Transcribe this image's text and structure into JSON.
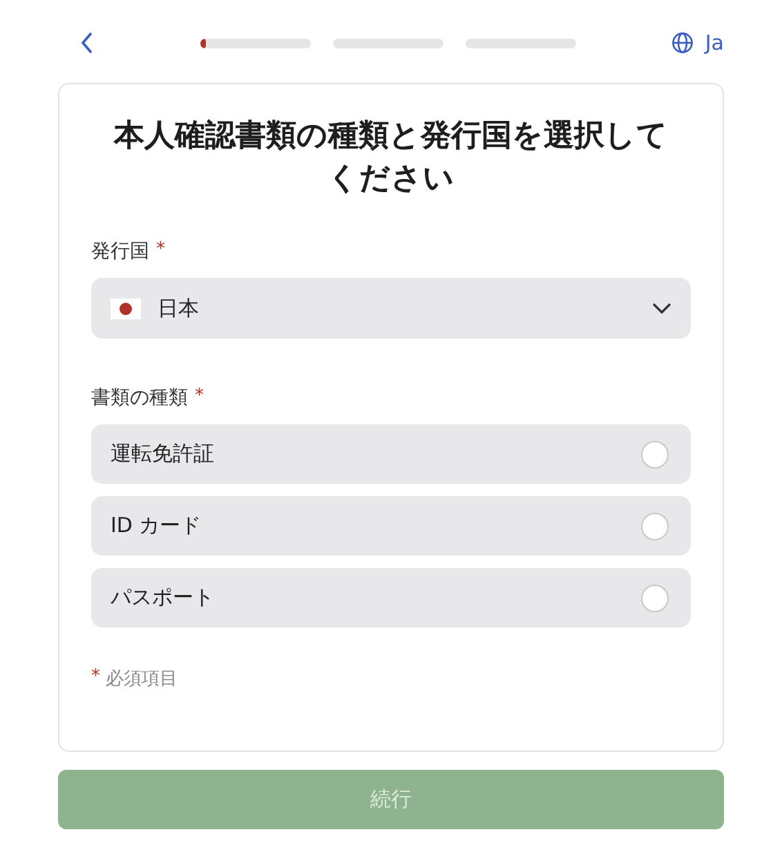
{
  "header": {
    "language": "Ja",
    "progress": [
      {
        "kind": "current",
        "level": 0.05
      },
      {
        "kind": "upcoming"
      },
      {
        "kind": "upcoming"
      }
    ]
  },
  "title": "本人確認書類の種類と発行国を選択してください",
  "country": {
    "label": "発行国",
    "required_mark": "*",
    "value": "日本"
  },
  "document_type": {
    "label": "書類の種類",
    "required_mark": "*",
    "options": [
      {
        "label": "運転免許証",
        "selected": false
      },
      {
        "label": "ID カード",
        "selected": false
      },
      {
        "label": "パスポート",
        "selected": false
      }
    ]
  },
  "required_note": {
    "mark": "*",
    "text": "必須項目"
  },
  "continue_button": {
    "label": "続行",
    "disabled": true
  }
}
